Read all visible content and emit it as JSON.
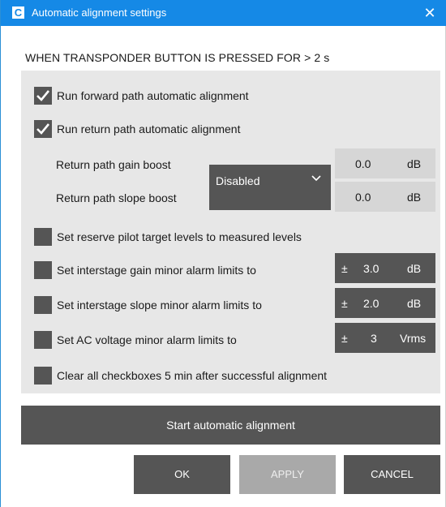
{
  "window": {
    "title": "Automatic alignment settings",
    "app_icon_glyph": "C",
    "close_glyph": "✕"
  },
  "header": "WHEN TRANSPONDER BUTTON IS PRESSED FOR  > 2 s",
  "options": {
    "forward": {
      "label": "Run forward path automatic alignment",
      "checked": true
    },
    "return": {
      "label": "Run return path automatic alignment",
      "checked": true
    },
    "gain_boost_label": "Return path gain boost",
    "slope_boost_label": "Return path slope boost",
    "boost_mode": "Disabled",
    "gain_boost": {
      "value": "0.0",
      "unit": "dB"
    },
    "slope_boost": {
      "value": "0.0",
      "unit": "dB"
    },
    "reserve_pilot": {
      "label": "Set reserve pilot target levels to measured levels",
      "checked": false
    },
    "interstage_gain": {
      "label": "Set interstage gain minor alarm limits to",
      "checked": false,
      "prefix": "±",
      "value": "3.0",
      "unit": "dB"
    },
    "interstage_slope": {
      "label": "Set interstage slope minor alarm limits to",
      "checked": false,
      "prefix": "±",
      "value": "2.0",
      "unit": "dB"
    },
    "ac_voltage": {
      "label": "Set AC voltage minor alarm limits to",
      "checked": false,
      "prefix": "±",
      "value": "3",
      "unit": "Vrms"
    },
    "clear_all": {
      "label": "Clear all checkboxes 5 min after successful alignment",
      "checked": false
    }
  },
  "buttons": {
    "start": "Start automatic alignment",
    "ok": "OK",
    "apply": "APPLY",
    "cancel": "CANCEL"
  },
  "colors": {
    "titlebar": "#1589e6",
    "panel": "#e7e7e7",
    "dark_control": "#555555",
    "disabled_button": "#a9a9a9"
  }
}
